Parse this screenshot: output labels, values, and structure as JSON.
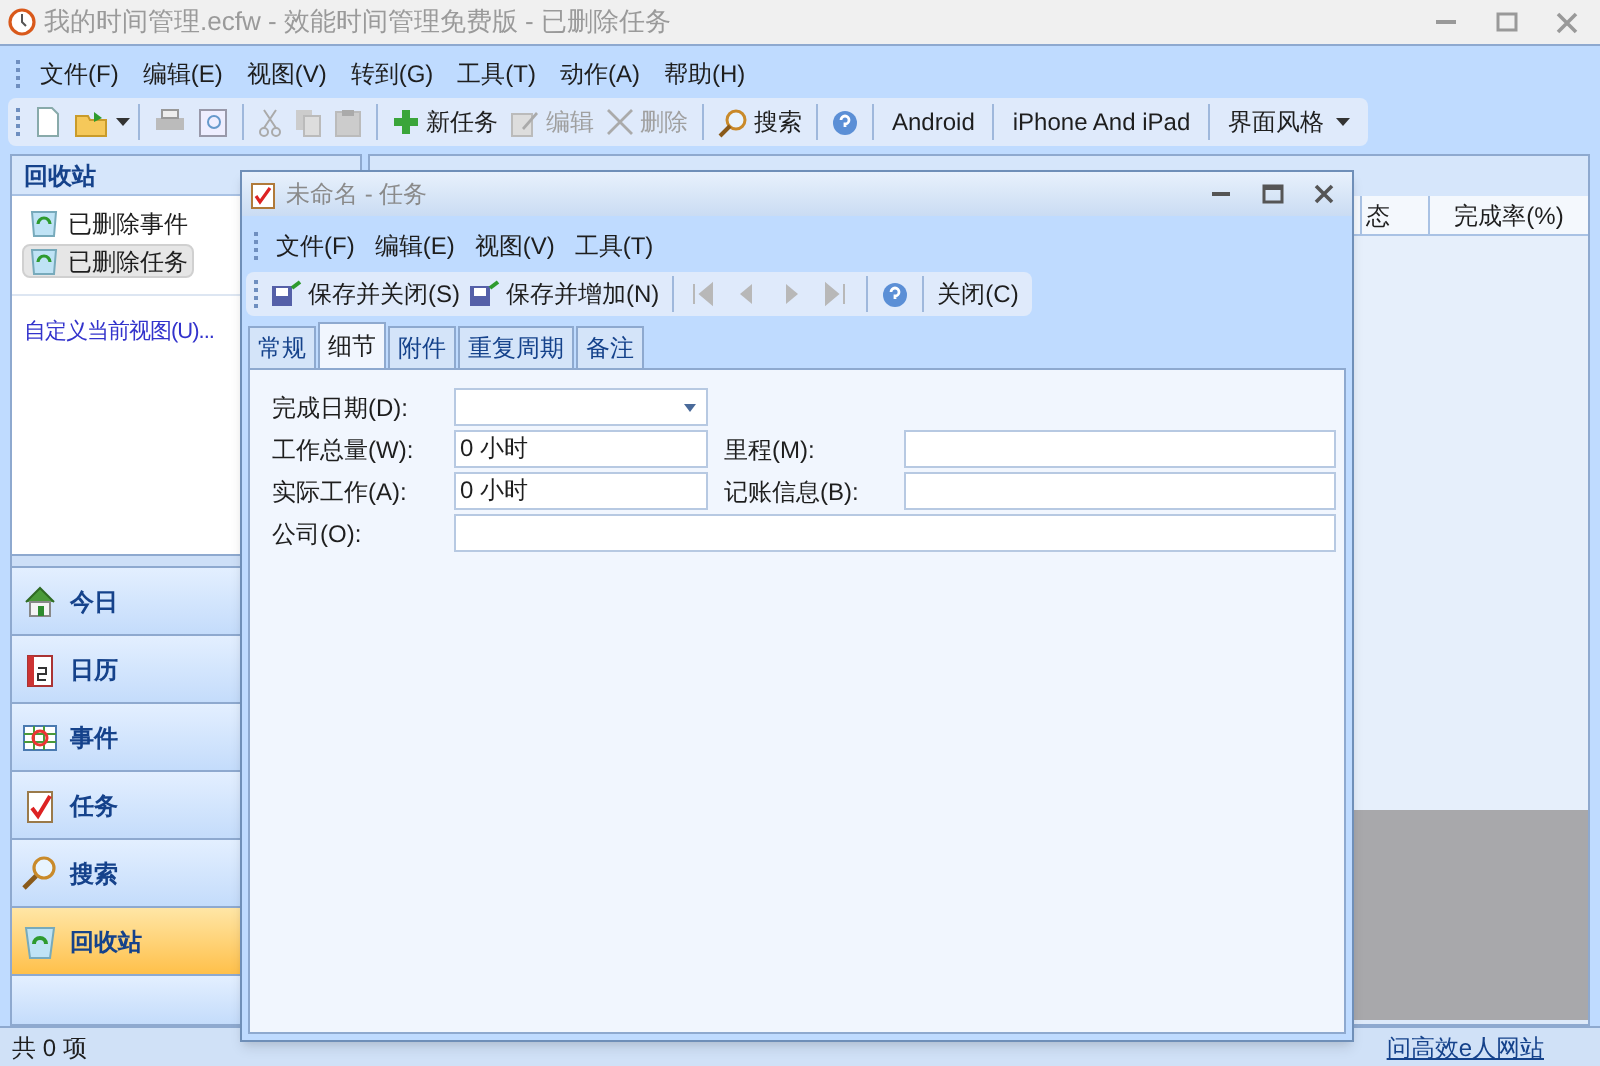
{
  "window": {
    "title": "我的时间管理.ecfw - 效能时间管理免费版 - 已删除任务"
  },
  "menu": [
    "文件(F)",
    "编辑(E)",
    "视图(V)",
    "转到(G)",
    "工具(T)",
    "动作(A)",
    "帮助(H)"
  ],
  "toolbar": [
    {
      "label": "新任务",
      "disabled": false
    },
    {
      "label": "编辑",
      "disabled": true
    },
    {
      "label": "删除",
      "disabled": true
    },
    {
      "label": "搜索",
      "disabled": false
    }
  ],
  "links_toolbar": [
    "Android",
    "iPhone And iPad",
    "界面风格"
  ],
  "sidebar": {
    "title": "回收站",
    "items": [
      {
        "label": "已删除事件",
        "selected": false
      },
      {
        "label": "已删除任务",
        "selected": true
      }
    ],
    "link": "自定义当前视图(U)...",
    "nav": [
      {
        "label": "今日",
        "selected": false
      },
      {
        "label": "日历",
        "selected": false
      },
      {
        "label": "事件",
        "selected": false
      },
      {
        "label": "任务",
        "selected": false
      },
      {
        "label": "搜索",
        "selected": false
      },
      {
        "label": "回收站",
        "selected": true
      }
    ]
  },
  "main": {
    "columns": [
      "态",
      "完成率(%)"
    ]
  },
  "status_bar": {
    "count": "共 0 项",
    "link": "问高效e人网站"
  },
  "dialog": {
    "title": "未命名 - 任务",
    "menu": [
      "文件(F)",
      "编辑(E)",
      "视图(V)",
      "工具(T)"
    ],
    "toolbar": [
      {
        "label": "保存并关闭(S)"
      },
      {
        "label": "保存并增加(N)"
      }
    ],
    "close": "关闭(C)",
    "tabs": [
      {
        "label": "常规",
        "selected": false
      },
      {
        "label": "细节",
        "selected": true
      },
      {
        "label": "附件",
        "selected": false
      },
      {
        "label": "重复周期",
        "selected": false
      },
      {
        "label": "备注",
        "selected": false
      }
    ],
    "fields": {
      "due_date": {
        "label": "完成日期(D):"
      },
      "total_work": {
        "label": "工作总量(W):",
        "value": "0 小时"
      },
      "actual_work": {
        "label": "实际工作(A):",
        "value": "0 小时"
      },
      "mileage": {
        "label": "里程(M):"
      },
      "billing": {
        "label": "记账信息(B):"
      },
      "company": {
        "label": "公司(O):"
      }
    }
  }
}
